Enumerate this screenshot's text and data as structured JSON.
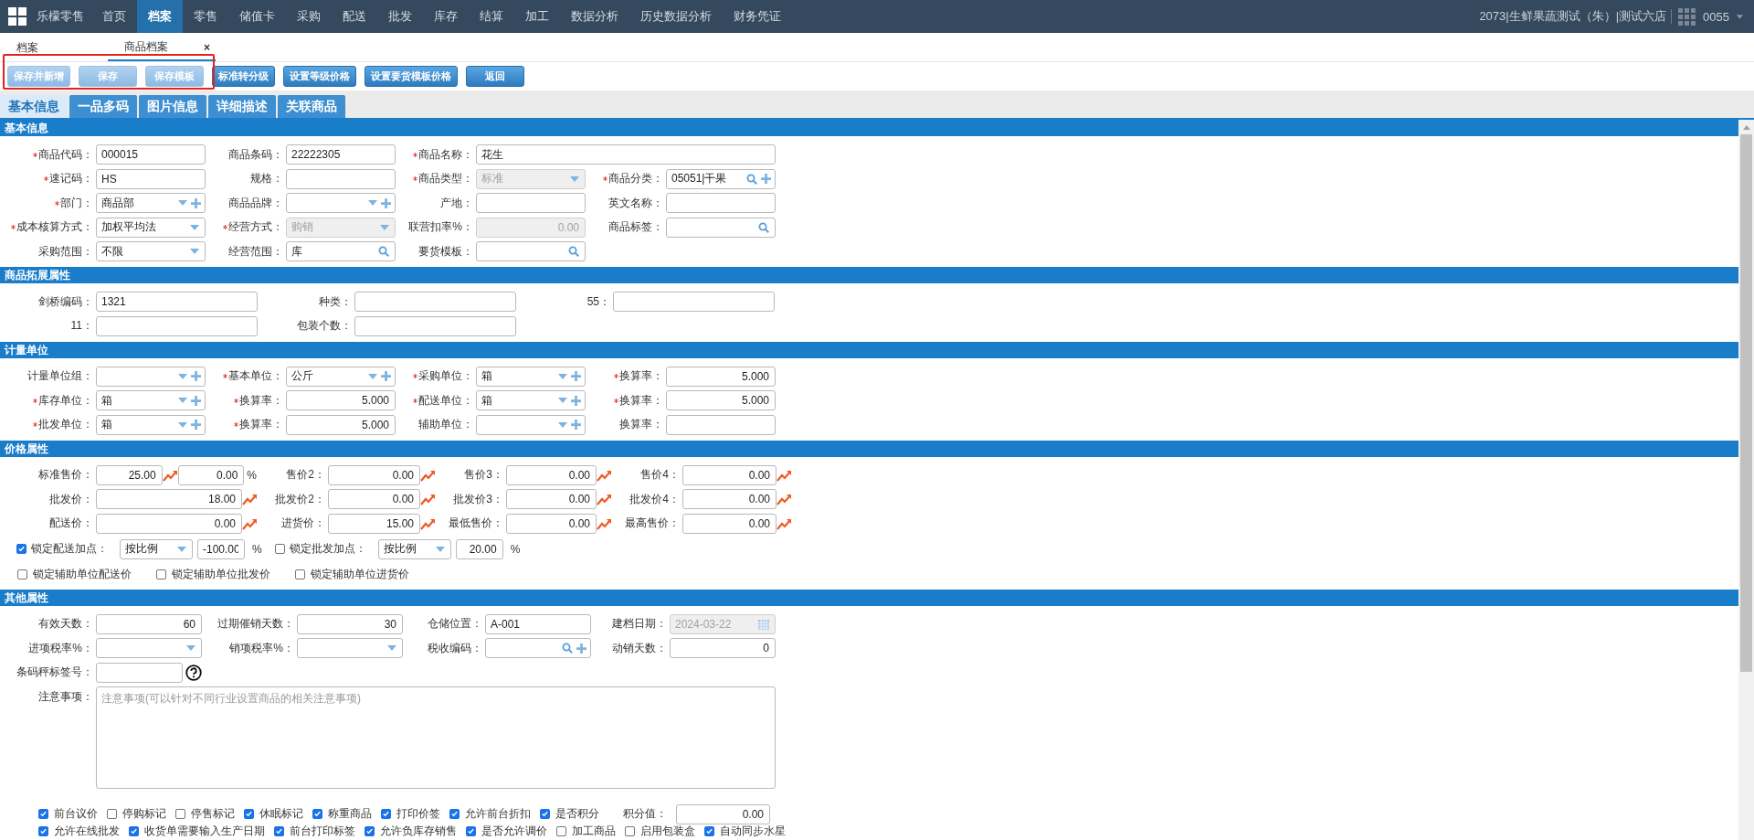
{
  "nav": {
    "brand": "乐檬零售",
    "items": [
      {
        "label": "首页",
        "selected": false
      },
      {
        "label": "档案",
        "selected": true
      },
      {
        "label": "零售",
        "selected": false
      },
      {
        "label": "储值卡",
        "selected": false
      },
      {
        "label": "采购",
        "selected": false
      },
      {
        "label": "配送",
        "selected": false
      },
      {
        "label": "批发",
        "selected": false
      },
      {
        "label": "库存",
        "selected": false
      },
      {
        "label": "结算",
        "selected": false
      },
      {
        "label": "加工",
        "selected": false
      },
      {
        "label": "数据分析",
        "selected": false
      },
      {
        "label": "历史数据分析",
        "selected": false
      },
      {
        "label": "财务凭证",
        "selected": false
      }
    ],
    "account": "2073|生鲜果蔬测试（朱）|测试六店",
    "user": "0055"
  },
  "page_tabs": [
    {
      "label": "档案",
      "selected": false
    },
    {
      "label": "商品档案",
      "selected": true,
      "close": "×"
    }
  ],
  "toolbar": [
    {
      "label": "保存并新增",
      "disabled": true
    },
    {
      "label": "保存",
      "disabled": true
    },
    {
      "label": "保存模板",
      "disabled": true
    },
    {
      "label": "标准转分级",
      "disabled": false
    },
    {
      "label": "设置等级价格",
      "disabled": false
    },
    {
      "label": "设置要货模板价格",
      "disabled": false
    },
    {
      "label": "返回",
      "disabled": false
    }
  ],
  "annotation": {
    "kind": "frame"
  },
  "form_tabs": [
    {
      "label": "基本信息",
      "selected": true
    },
    {
      "label": "一品多码",
      "selected": false
    },
    {
      "label": "图片信息",
      "selected": false
    },
    {
      "label": "详细描述",
      "selected": false
    },
    {
      "label": "关联商品",
      "selected": false
    }
  ],
  "sections": [
    {
      "title": "基本信息",
      "kind": "basic",
      "rows": [
        [
          {
            "label": "商品代码：",
            "required": true,
            "kind": "text",
            "value": "000015"
          },
          {
            "label": "商品条码：",
            "kind": "text",
            "value": "22222305"
          },
          {
            "label": "商品名称：",
            "required": true,
            "kind": "text",
            "value": "花生",
            "wide": true
          }
        ],
        [
          {
            "label": "速记码：",
            "required": true,
            "kind": "text",
            "value": "HS"
          },
          {
            "label": "规格：",
            "kind": "text"
          },
          {
            "label": "商品类型：",
            "required": true,
            "kind": "select",
            "value": "标准",
            "disabled": true
          },
          {
            "label": "商品分类：",
            "required": true,
            "kind": "search",
            "value": "05051|干果",
            "add": true
          }
        ],
        [
          {
            "label": "部门：",
            "required": true,
            "kind": "select",
            "value": "商品部",
            "add": true
          },
          {
            "label": "商品品牌：",
            "kind": "select",
            "add": true
          },
          {
            "label": "产地：",
            "kind": "text"
          },
          {
            "label": "英文名称：",
            "kind": "text"
          }
        ],
        [
          {
            "label": "成本核算方式：",
            "required": true,
            "kind": "select",
            "value": "加权平均法"
          },
          {
            "label": "经营方式：",
            "required": true,
            "kind": "select",
            "value": "购销",
            "disabled": true
          },
          {
            "label": "联营扣率%：",
            "kind": "number",
            "value": "0.00",
            "disabled": true
          },
          {
            "label": "商品标签：",
            "kind": "search"
          }
        ],
        [
          {
            "label": "采购范围：",
            "kind": "select",
            "value": "不限"
          },
          {
            "label": "经营范围：",
            "kind": "search",
            "value": "库"
          },
          {
            "label": "要货模板：",
            "kind": "search"
          }
        ]
      ]
    },
    {
      "title": "商品拓展属性",
      "kind": "extend",
      "rows": [
        [
          {
            "label": "剑桥编码：",
            "kind": "text",
            "value": "1321"
          },
          {
            "label": "种类：",
            "kind": "text"
          },
          {
            "label": "55：",
            "kind": "text"
          }
        ],
        [
          {
            "label": "11：",
            "kind": "text"
          },
          {
            "label": "包装个数：",
            "kind": "text"
          }
        ]
      ]
    },
    {
      "title": "计量单位",
      "kind": "basic",
      "rows": [
        [
          {
            "label": "计量单位组：",
            "kind": "select",
            "add": true
          },
          {
            "label": "基本单位：",
            "required": true,
            "kind": "select",
            "value": "公斤",
            "add": true
          },
          {
            "label": "采购单位：",
            "required": true,
            "kind": "select",
            "value": "箱",
            "add": true
          },
          {
            "label": "换算率：",
            "required": true,
            "kind": "number",
            "value": "5.000"
          }
        ],
        [
          {
            "label": "库存单位：",
            "required": true,
            "kind": "select",
            "value": "箱",
            "add": true
          },
          {
            "label": "换算率：",
            "required": true,
            "kind": "number",
            "value": "5.000"
          },
          {
            "label": "配送单位：",
            "required": true,
            "kind": "select",
            "value": "箱",
            "add": true
          },
          {
            "label": "换算率：",
            "required": true,
            "kind": "number",
            "value": "5.000"
          }
        ],
        [
          {
            "label": "批发单位：",
            "required": true,
            "kind": "select",
            "value": "箱",
            "add": true
          },
          {
            "label": "换算率：",
            "required": true,
            "kind": "number",
            "value": "5.000"
          },
          {
            "label": "辅助单位：",
            "kind": "select",
            "add": true
          },
          {
            "label": "换算率：",
            "kind": "number"
          }
        ]
      ]
    },
    {
      "title": "价格属性",
      "kind": "price",
      "rows": [
        [
          {
            "label": "标准售价：",
            "kind": "price",
            "value": "25.00",
            "markup": {
              "value": "0.00",
              "unit": "%"
            }
          },
          {
            "label": "售价2：",
            "kind": "price",
            "value": "0.00"
          },
          {
            "label": "售价3：",
            "kind": "price",
            "value": "0.00"
          },
          {
            "label": "售价4：",
            "kind": "price",
            "value": "0.00"
          }
        ],
        [
          {
            "label": "批发价：",
            "kind": "price",
            "value": "18.00"
          },
          {
            "label": "批发价2：",
            "kind": "price",
            "value": "0.00"
          },
          {
            "label": "批发价3：",
            "kind": "price",
            "value": "0.00"
          },
          {
            "label": "批发价4：",
            "kind": "price",
            "value": "0.00"
          }
        ],
        [
          {
            "label": "配送价：",
            "kind": "price",
            "value": "0.00"
          },
          {
            "label": "进货价：",
            "kind": "price",
            "value": "15.00"
          },
          {
            "label": "最低售价：",
            "kind": "price",
            "value": "0.00"
          },
          {
            "label": "最高售价：",
            "kind": "price",
            "value": "0.00"
          }
        ]
      ],
      "locks": [
        {
          "checked": true,
          "label": "锁定配送加点：",
          "mode": "按比例",
          "value": "-100.00",
          "unit": "%"
        },
        {
          "checked": false,
          "label": "锁定批发加点：",
          "mode": "按比例",
          "value": "20.00",
          "unit": "%"
        }
      ],
      "aux_checks": [
        {
          "checked": false,
          "label": "锁定辅助单位配送价"
        },
        {
          "checked": false,
          "label": "锁定辅助单位批发价"
        },
        {
          "checked": false,
          "label": "锁定辅助单位进货价"
        }
      ]
    },
    {
      "title": "其他属性",
      "kind": "other",
      "rows": [
        [
          {
            "label": "有效天数：",
            "kind": "number",
            "value": "60"
          },
          {
            "label": "过期催销天数：",
            "kind": "number",
            "value": "30"
          },
          {
            "label": "仓储位置：",
            "kind": "text",
            "value": "A-001"
          },
          {
            "label": "建档日期：",
            "kind": "date",
            "value": "2024-03-22",
            "disabled": true
          }
        ],
        [
          {
            "label": "进项税率%：",
            "kind": "select"
          },
          {
            "label": "销项税率%：",
            "kind": "select"
          },
          {
            "label": "税收编码：",
            "kind": "search",
            "add": true
          },
          {
            "label": "动销天数：",
            "kind": "number",
            "value": "0"
          }
        ],
        [
          {
            "label": "条码秤标签号：",
            "kind": "text",
            "help": true
          }
        ],
        [
          {
            "label": "注意事项：",
            "kind": "textarea",
            "placeholder": "注意事项(可以针对不同行业设置商品的相关注意事项)",
            "wide": true
          }
        ]
      ],
      "flags": [
        [
          {
            "kind": "check",
            "label": "前台议价",
            "checked": true
          },
          {
            "kind": "check",
            "label": "停购标记",
            "checked": false
          },
          {
            "kind": "check",
            "label": "停售标记",
            "checked": false
          },
          {
            "kind": "check",
            "label": "休眠标记",
            "checked": true
          },
          {
            "kind": "check",
            "label": "称重商品",
            "checked": true
          },
          {
            "kind": "check",
            "label": "打印价签",
            "checked": true
          },
          {
            "kind": "check",
            "label": "允许前台折扣",
            "checked": true
          },
          {
            "kind": "check",
            "label": "是否积分",
            "checked": true
          },
          {
            "kind": "field",
            "label": "积分值：",
            "value": "0.00"
          }
        ],
        [
          {
            "kind": "check",
            "label": "允许在线批发",
            "checked": true
          },
          {
            "kind": "check",
            "label": "收货单需要输入生产日期",
            "checked": true
          },
          {
            "kind": "check",
            "label": "前台打印标签",
            "checked": true
          },
          {
            "kind": "check",
            "label": "允许负库存销售",
            "checked": true
          },
          {
            "kind": "check",
            "label": "是否允许调价",
            "checked": true
          },
          {
            "kind": "check",
            "label": "加工商品",
            "checked": false
          },
          {
            "kind": "check",
            "label": "启用包装盒",
            "checked": false
          },
          {
            "kind": "check",
            "label": "自动同步水星",
            "checked": true
          }
        ]
      ]
    }
  ]
}
